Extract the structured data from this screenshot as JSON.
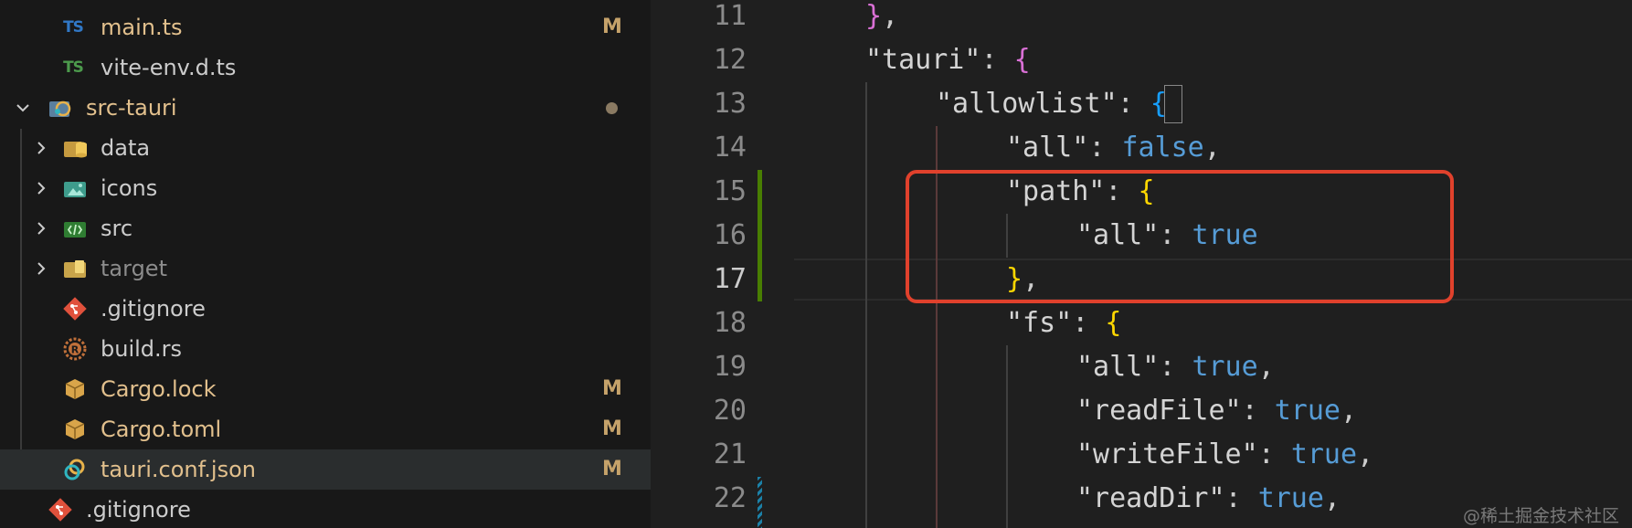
{
  "explorer": {
    "items": [
      {
        "label": "main.ts",
        "status": "M",
        "icon": "typescript-icon",
        "color": "#e2c08d"
      },
      {
        "label": "vite-env.d.ts",
        "status": "",
        "icon": "typescript-icon",
        "color": "#cccccc"
      },
      {
        "label": "src-tauri",
        "status": "dot",
        "icon": "tauri-folder-icon",
        "color": "#e2c08d"
      },
      {
        "label": "data",
        "status": "",
        "icon": "database-folder-icon",
        "color": "#cccccc"
      },
      {
        "label": "icons",
        "status": "",
        "icon": "image-folder-icon",
        "color": "#cccccc"
      },
      {
        "label": "src",
        "status": "",
        "icon": "source-folder-icon",
        "color": "#cccccc"
      },
      {
        "label": "target",
        "status": "",
        "icon": "target-folder-icon",
        "color": "#8c8c8c"
      },
      {
        "label": ".gitignore",
        "status": "",
        "icon": "git-icon",
        "color": "#cccccc"
      },
      {
        "label": "build.rs",
        "status": "",
        "icon": "rust-icon",
        "color": "#cccccc"
      },
      {
        "label": "Cargo.lock",
        "status": "M",
        "icon": "cargo-icon",
        "color": "#e2c08d"
      },
      {
        "label": "Cargo.toml",
        "status": "M",
        "icon": "cargo-icon",
        "color": "#e2c08d"
      },
      {
        "label": "tauri.conf.json",
        "status": "M",
        "icon": "tauri-icon",
        "color": "#e2c08d"
      },
      {
        "label": ".gitignore",
        "status": "",
        "icon": "git-icon",
        "color": "#cccccc"
      }
    ],
    "ts_badge": "TS",
    "modified_letter": "M"
  },
  "editor": {
    "line_numbers": [
      "11",
      "12",
      "13",
      "14",
      "15",
      "16",
      "17",
      "18",
      "19",
      "20",
      "21",
      "22"
    ],
    "active_line": "17",
    "lines": {
      "l11": {
        "close": "}",
        "comma": ","
      },
      "l12": {
        "key": "\"tauri\"",
        "colon": ": ",
        "open": "{"
      },
      "l13": {
        "key": "\"allowlist\"",
        "colon": ": ",
        "open": "{"
      },
      "l14": {
        "key": "\"all\"",
        "colon": ": ",
        "value": "false",
        "comma": ","
      },
      "l15": {
        "key": "\"path\"",
        "colon": ": ",
        "open": "{"
      },
      "l16": {
        "key": "\"all\"",
        "colon": ": ",
        "value": "true"
      },
      "l17": {
        "close": "}",
        "comma": ","
      },
      "l18": {
        "key": "\"fs\"",
        "colon": ": ",
        "open": "{"
      },
      "l19": {
        "key": "\"all\"",
        "colon": ": ",
        "value": "true",
        "comma": ","
      },
      "l20": {
        "key": "\"readFile\"",
        "colon": ": ",
        "value": "true",
        "comma": ","
      },
      "l21": {
        "key": "\"writeFile\"",
        "colon": ": ",
        "value": "true",
        "comma": ","
      },
      "l22": {
        "key": "\"readDir\"",
        "colon": ": ",
        "value": "true",
        "comma": ","
      }
    }
  },
  "watermark": "@稀土掘金技术社区",
  "colors": {
    "modified": "#c5a26a",
    "highlight_box": "#e0412c",
    "gutter_added": "#487e02"
  }
}
